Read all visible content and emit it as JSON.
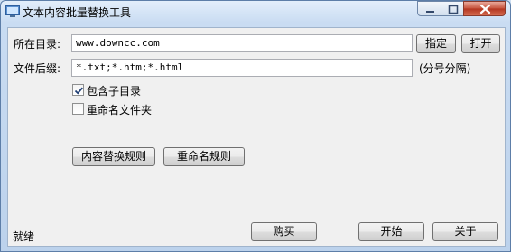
{
  "window": {
    "title": "文本内容批量替换工具"
  },
  "directory": {
    "label": "所在目录:",
    "value": "www.downcc.com",
    "specify_button": "指定",
    "open_button": "打开"
  },
  "extension": {
    "label": "文件后缀:",
    "value": "*.txt;*.htm;*.html",
    "hint": "(分号分隔)"
  },
  "options": {
    "include_subdirs": {
      "label": "包含子目录",
      "checked": true
    },
    "rename_folders": {
      "label": "重命名文件夹",
      "checked": false
    }
  },
  "rules": {
    "content_replace": "内容替换规则",
    "rename": "重命名规则"
  },
  "status": {
    "text": "就绪"
  },
  "actions": {
    "buy": "购买",
    "start": "开始",
    "about": "关于"
  }
}
